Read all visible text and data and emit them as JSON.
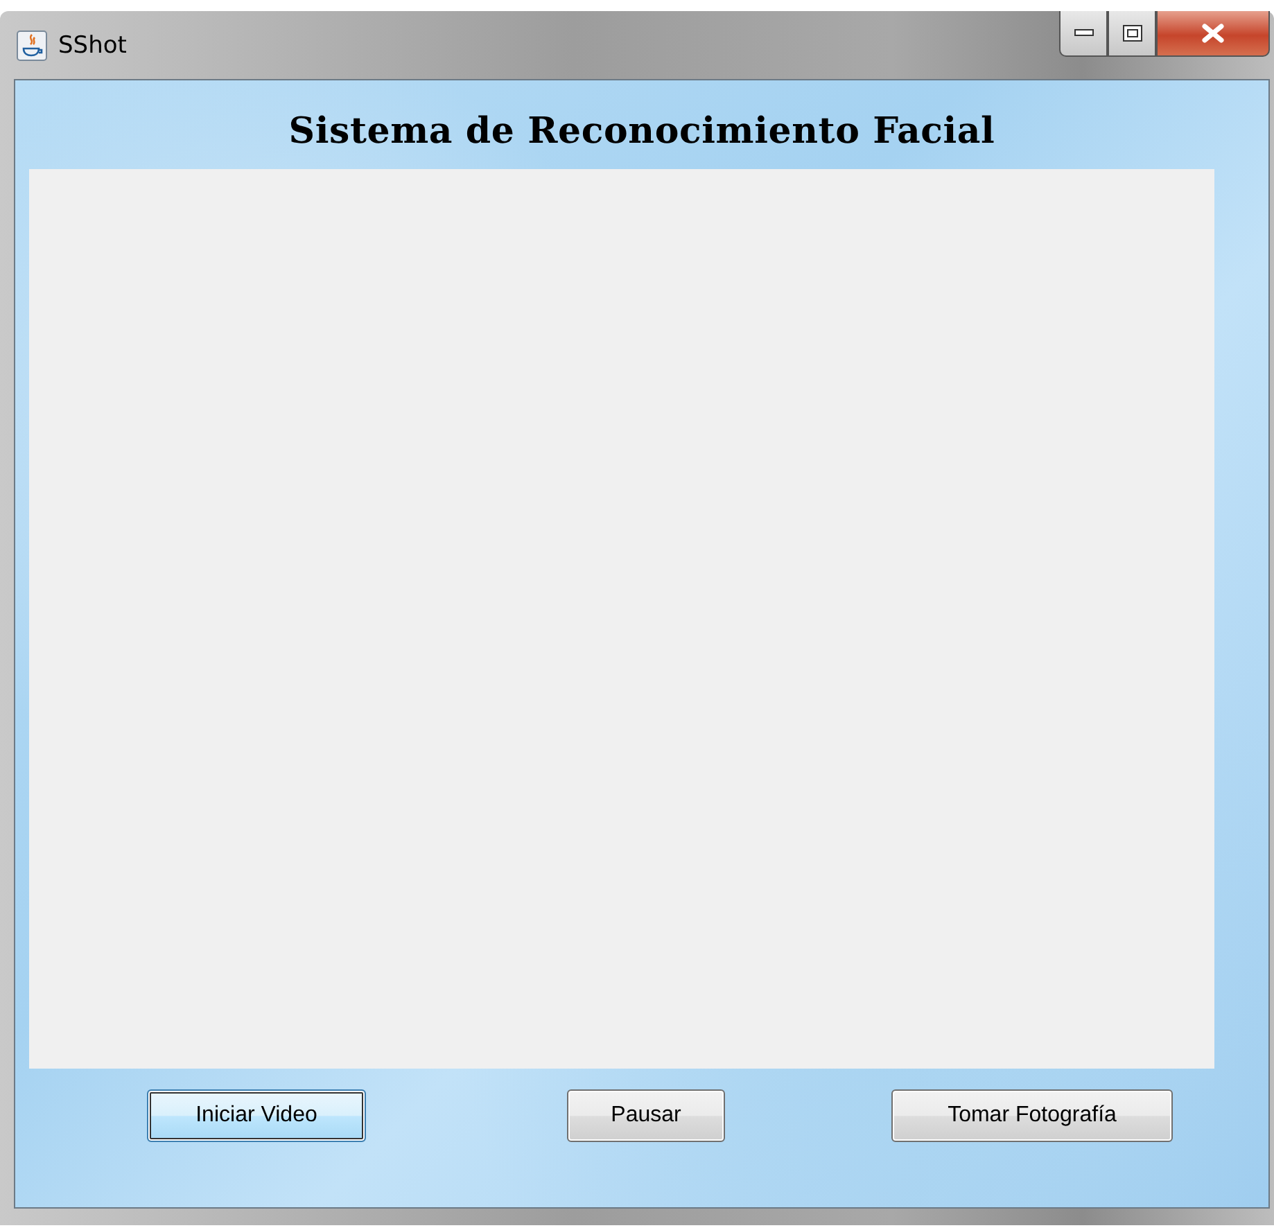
{
  "window": {
    "title": "SShot"
  },
  "heading": "Sistema de Reconocimiento Facial",
  "video_panel": {
    "kind": "empty"
  },
  "buttons": [
    {
      "label": "Iniciar Video",
      "focused": true
    },
    {
      "label": "Pausar",
      "focused": false
    },
    {
      "label": "Tomar Fotografía",
      "focused": false
    }
  ]
}
